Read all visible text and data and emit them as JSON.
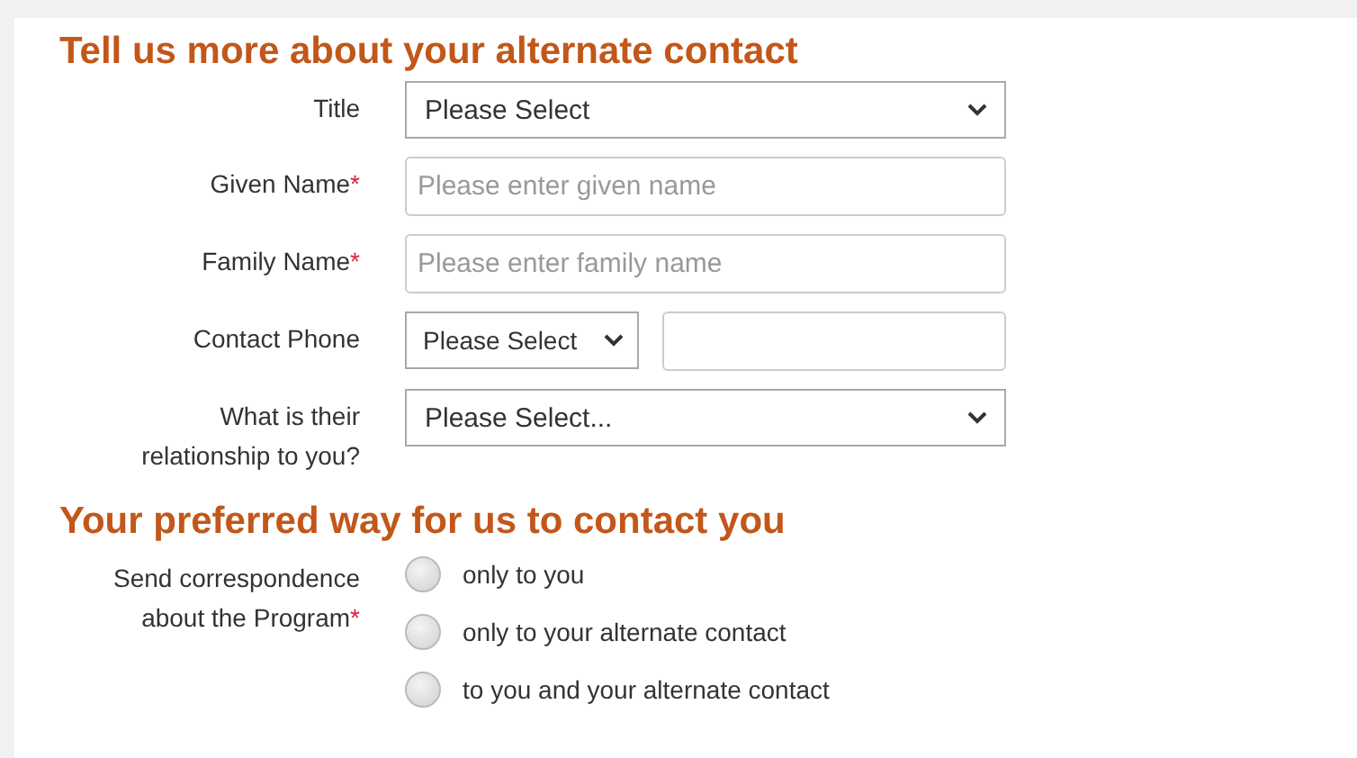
{
  "sections": [
    {
      "heading": "Tell us more about your alternate contact",
      "fields": [
        {
          "label": "Title",
          "kind": "select",
          "value": "Please Select"
        },
        {
          "label": "Given Name",
          "required_mark": "*",
          "kind": "input",
          "placeholder": "Please enter given name"
        },
        {
          "label": "Family Name",
          "required_mark": "*",
          "kind": "input",
          "placeholder": "Please enter family name"
        },
        {
          "label": "Contact Phone",
          "kind": "phone",
          "value": "Please Select"
        },
        {
          "label": "What is their relationship to you?",
          "kind": "select",
          "value": "Please Select..."
        }
      ]
    },
    {
      "heading": "Your preferred way for us to contact you",
      "fields": [
        {
          "label": "Send correspondence about the Program",
          "required_mark": "*",
          "kind": "radio",
          "options": [
            {
              "label": "only to you",
              "selected": false
            },
            {
              "label": "only to your alternate contact",
              "selected": false
            },
            {
              "label": "to you and your alternate contact",
              "selected": false
            }
          ]
        }
      ]
    }
  ]
}
